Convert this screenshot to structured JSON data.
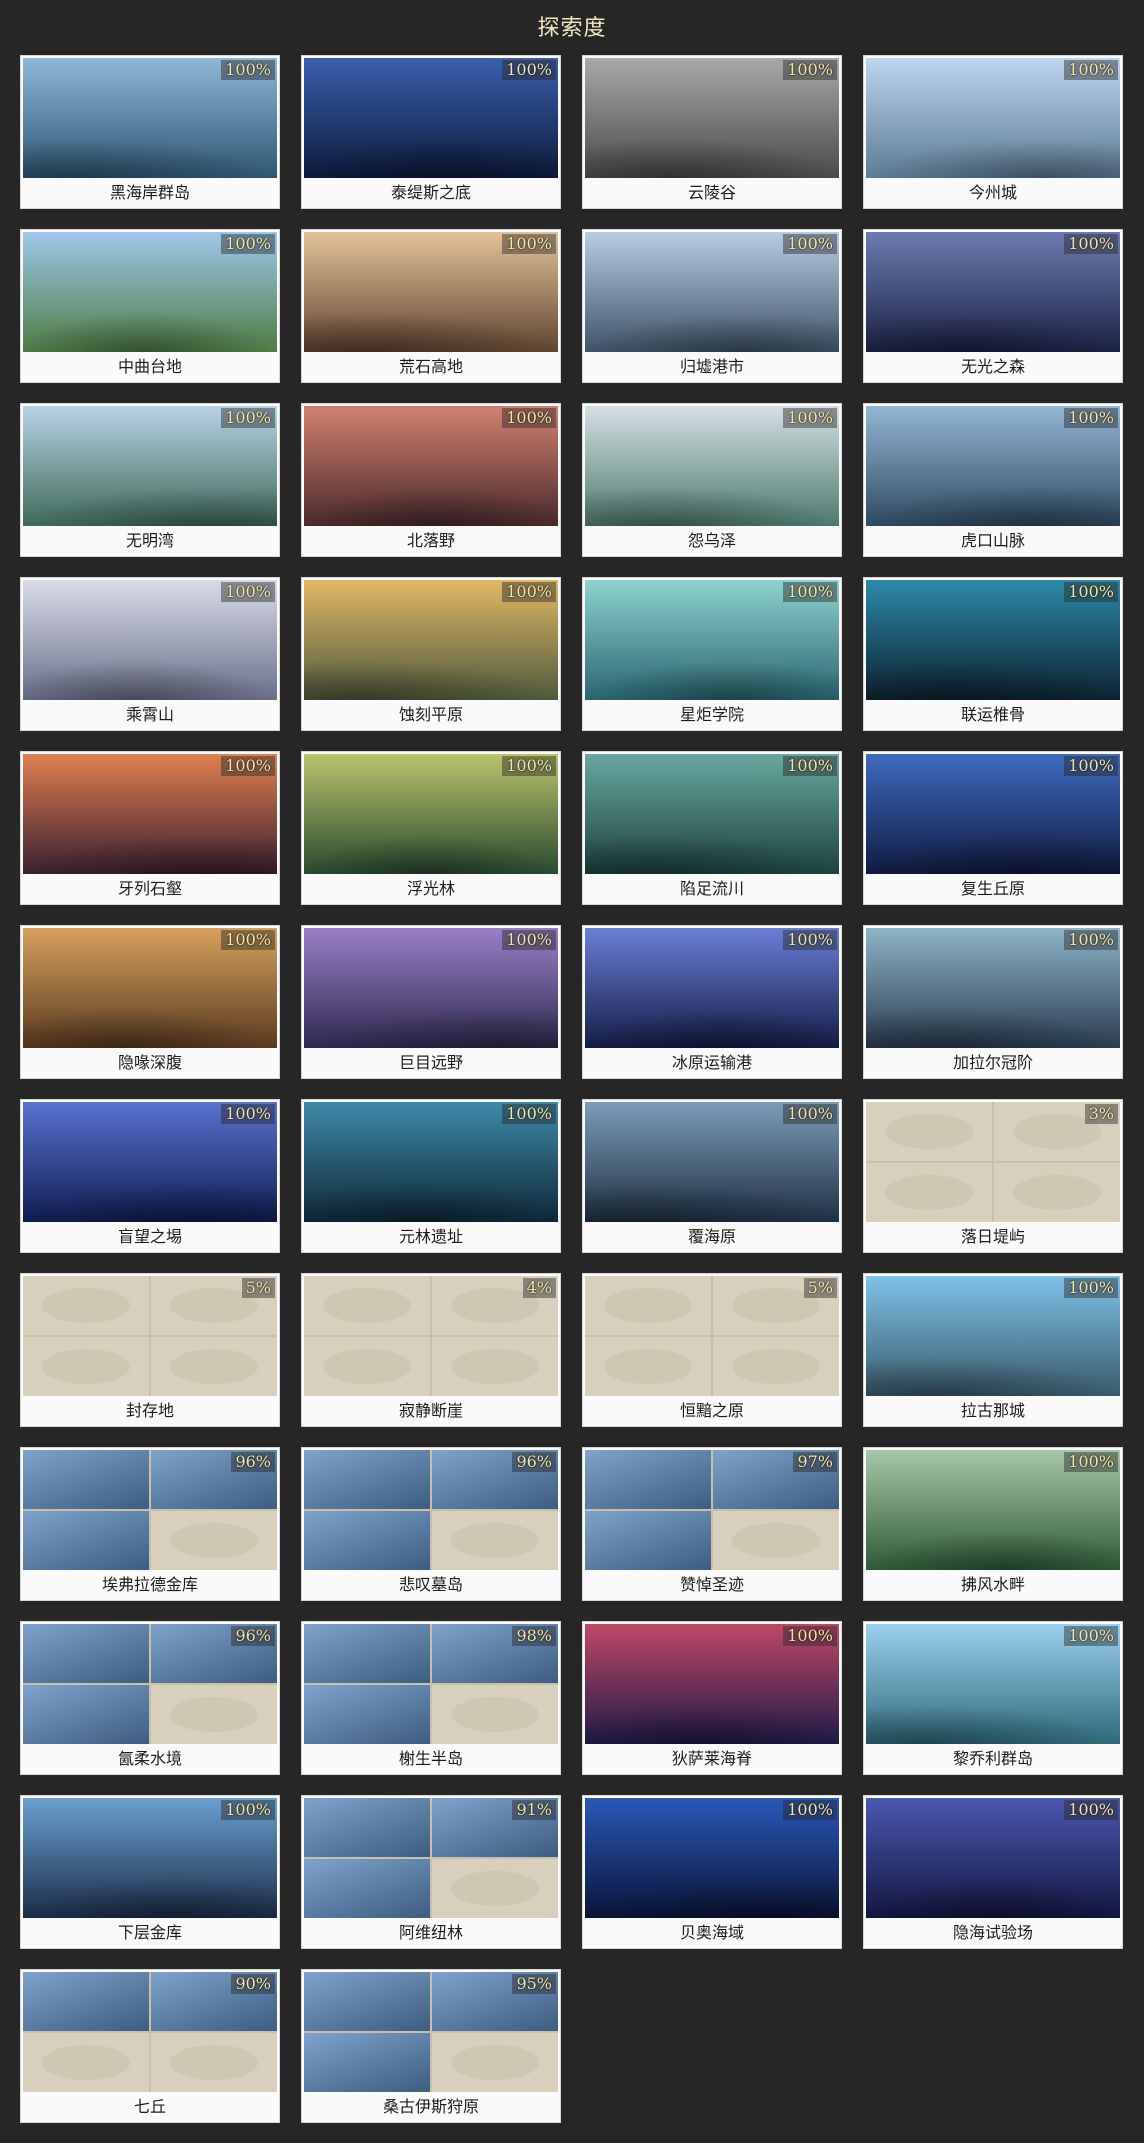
{
  "title": "探索度",
  "regions": [
    {
      "name": "黑海岸群岛",
      "progress": "100%",
      "c1": "#8fb7d8",
      "c2": "#2f5672"
    },
    {
      "name": "泰缇斯之底",
      "progress": "100%",
      "c1": "#3b5fae",
      "c2": "#0c1a3a"
    },
    {
      "name": "云陵谷",
      "progress": "100%",
      "c1": "#a7a9aa",
      "c2": "#4b4a48"
    },
    {
      "name": "今州城",
      "progress": "100%",
      "c1": "#bcd6ee",
      "c2": "#5d7b94"
    },
    {
      "name": "中曲台地",
      "progress": "100%",
      "c1": "#9ec8e8",
      "c2": "#4f7c45"
    },
    {
      "name": "荒石高地",
      "progress": "100%",
      "c1": "#e4c39a",
      "c2": "#5f4431"
    },
    {
      "name": "归墟港市",
      "progress": "100%",
      "c1": "#b9cde2",
      "c2": "#3f5368"
    },
    {
      "name": "无光之森",
      "progress": "100%",
      "c1": "#6c7bb0",
      "c2": "#1b2244"
    },
    {
      "name": "无明湾",
      "progress": "100%",
      "c1": "#b8d3e6",
      "c2": "#3f6a5a"
    },
    {
      "name": "北落野",
      "progress": "100%",
      "c1": "#d28070",
      "c2": "#4a2a2c"
    },
    {
      "name": "怨乌泽",
      "progress": "100%",
      "c1": "#d6e0e4",
      "c2": "#4d7a6e"
    },
    {
      "name": "虎口山脉",
      "progress": "100%",
      "c1": "#94b6d4",
      "c2": "#2e4a60"
    },
    {
      "name": "乘霄山",
      "progress": "100%",
      "c1": "#d8dce8",
      "c2": "#6a6f8a"
    },
    {
      "name": "蚀刻平原",
      "progress": "100%",
      "c1": "#e2b864",
      "c2": "#4e5a3c"
    },
    {
      "name": "星炬学院",
      "progress": "100%",
      "c1": "#8ed3d0",
      "c2": "#2a6670"
    },
    {
      "name": "联运椎骨",
      "progress": "100%",
      "c1": "#2c8aa8",
      "c2": "#0d2230"
    },
    {
      "name": "牙列石壑",
      "progress": "100%",
      "c1": "#e08050",
      "c2": "#3a2030"
    },
    {
      "name": "浮光林",
      "progress": "100%",
      "c1": "#b9c46c",
      "c2": "#2a4a30"
    },
    {
      "name": "陷足流川",
      "progress": "100%",
      "c1": "#68a8a0",
      "c2": "#1d4240"
    },
    {
      "name": "复生丘原",
      "progress": "100%",
      "c1": "#3f6bc0",
      "c2": "#101a40"
    },
    {
      "name": "隐喙深腹",
      "progress": "100%",
      "c1": "#d7a25e",
      "c2": "#5a3a20"
    },
    {
      "name": "巨目远野",
      "progress": "100%",
      "c1": "#9a7fc8",
      "c2": "#2e2a50"
    },
    {
      "name": "冰原运输港",
      "progress": "100%",
      "c1": "#6c7fd8",
      "c2": "#141c46"
    },
    {
      "name": "加拉尔冠阶",
      "progress": "100%",
      "c1": "#8fb4c8",
      "c2": "#2a3c50"
    },
    {
      "name": "盲望之埸",
      "progress": "100%",
      "c1": "#5a72d0",
      "c2": "#101c50"
    },
    {
      "name": "元林遗址",
      "progress": "100%",
      "c1": "#3e8aa8",
      "c2": "#0f2838"
    },
    {
      "name": "覆海原",
      "progress": "100%",
      "c1": "#7c9cb8",
      "c2": "#203044"
    },
    {
      "name": "落日堤屿",
      "progress": "3%",
      "unlocked": 0
    },
    {
      "name": "封存地",
      "progress": "5%",
      "unlocked": 0
    },
    {
      "name": "寂静断崖",
      "progress": "4%",
      "unlocked": 0
    },
    {
      "name": "恒黯之原",
      "progress": "5%",
      "unlocked": 0
    },
    {
      "name": "拉古那城",
      "progress": "100%",
      "c1": "#7ec2e8",
      "c2": "#3a5a6a"
    },
    {
      "name": "埃弗拉德金库",
      "progress": "96%",
      "unlocked": 3
    },
    {
      "name": "悲叹墓岛",
      "progress": "96%",
      "unlocked": 3
    },
    {
      "name": "赞悼圣迹",
      "progress": "97%",
      "unlocked": 3
    },
    {
      "name": "拂风水畔",
      "progress": "100%",
      "c1": "#a8c8a8",
      "c2": "#2f5a38"
    },
    {
      "name": "氤柔水境",
      "progress": "96%",
      "unlocked": 3
    },
    {
      "name": "榭生半岛",
      "progress": "98%",
      "unlocked": 3
    },
    {
      "name": "狄萨莱海脊",
      "progress": "100%",
      "c1": "#c04868",
      "c2": "#1e1a46"
    },
    {
      "name": "黎乔利群岛",
      "progress": "100%",
      "c1": "#9cd0ee",
      "c2": "#2f6a7a"
    },
    {
      "name": "下层金库",
      "progress": "100%",
      "c1": "#6aa0d0",
      "c2": "#1c2c48"
    },
    {
      "name": "阿维纽林",
      "progress": "91%",
      "unlocked": 3
    },
    {
      "name": "贝奥海域",
      "progress": "100%",
      "c1": "#2a58b8",
      "c2": "#0a1438"
    },
    {
      "name": "隐海试验场",
      "progress": "100%",
      "c1": "#4c58b0",
      "c2": "#121640"
    },
    {
      "name": "七丘",
      "progress": "90%",
      "unlocked": 2
    },
    {
      "name": "桑古伊斯狩原",
      "progress": "95%",
      "unlocked": 3
    }
  ]
}
